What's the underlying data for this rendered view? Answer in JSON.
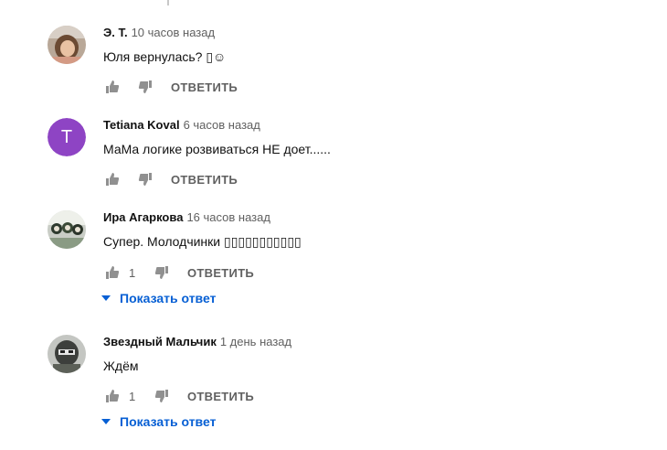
{
  "labels": {
    "reply": "ОТВЕТИТЬ",
    "show_reply": "Показать ответ"
  },
  "comments": [
    {
      "author": "Э. Т.",
      "time": "10 часов назад",
      "text": "Юля вернулась? ▯☺",
      "likes": ""
    },
    {
      "author": "Tetiana Koval",
      "time": "6 часов назад",
      "text": "МаМа логике розвиваться НЕ доет......",
      "likes": "",
      "avatar_letter": "T",
      "avatar_color": "#8e44c4"
    },
    {
      "author": "Ира Агаркова",
      "time": "16 часов назад",
      "text": "Супер. Молодчинки ▯▯▯▯▯▯▯▯▯▯▯",
      "likes": "1"
    },
    {
      "author": "Звездный Мальчик",
      "time": "1 день назад",
      "text": "Ждём",
      "likes": "1"
    }
  ],
  "colors": {
    "link": "#065fd4",
    "meta": "#606060",
    "icon": "#909090"
  },
  "icons": [
    "thumbs-up-icon",
    "thumbs-down-icon",
    "caret-down-icon"
  ]
}
